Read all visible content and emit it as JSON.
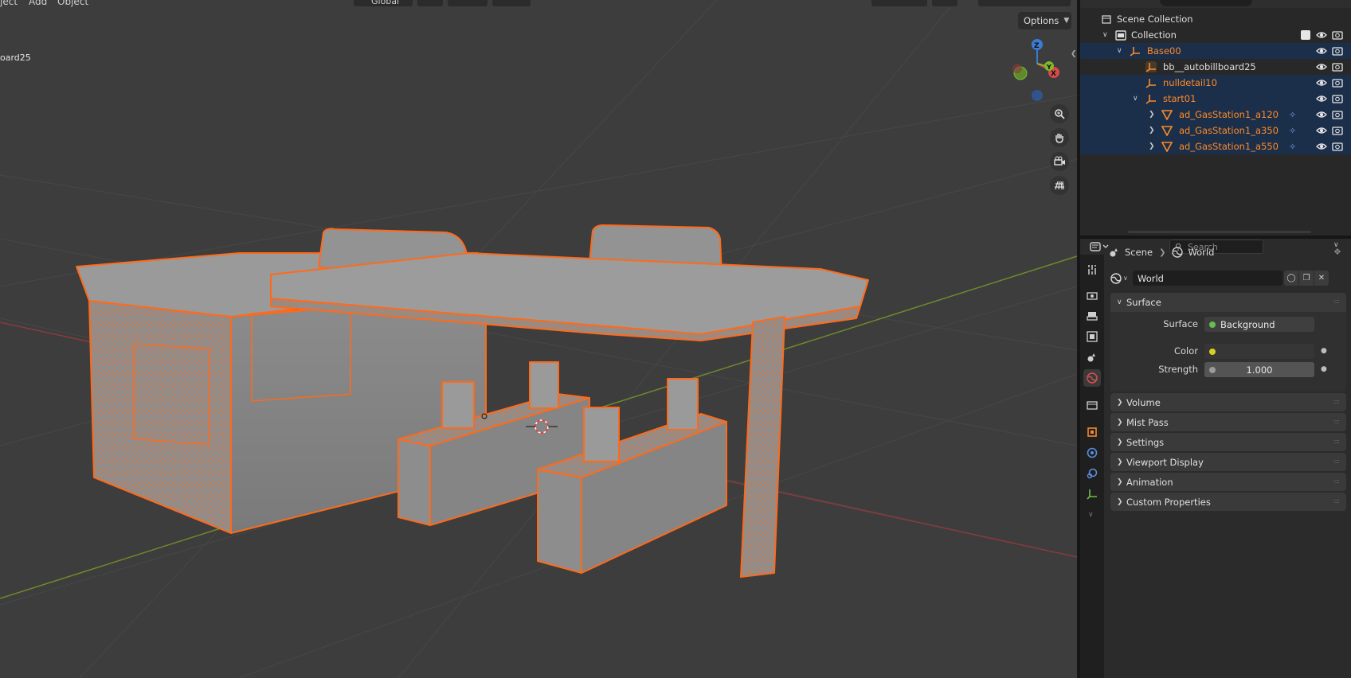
{
  "viewport": {
    "menu": [
      "ject",
      "Add",
      "Object"
    ],
    "transform_orientation": "Global",
    "active_object_label": "oard25",
    "options_label": "Options",
    "gizmo": {
      "z": "Z",
      "y": "Y",
      "x": "X"
    }
  },
  "outliner": {
    "rows": [
      {
        "label": "Scene Collection"
      },
      {
        "label": "Collection"
      },
      {
        "label": "Base00"
      },
      {
        "label": "bb__autobillboard25"
      },
      {
        "label": "nulldetail10"
      },
      {
        "label": "start01"
      },
      {
        "label": "ad_GasStation1_a120"
      },
      {
        "label": "ad_GasStation1_a350"
      },
      {
        "label": "ad_GasStation1_a550"
      }
    ]
  },
  "properties": {
    "search_placeholder": "Search",
    "breadcrumb": {
      "scene": "Scene",
      "world": "World"
    },
    "world_name": "World",
    "panels": {
      "surface": {
        "title": "Surface",
        "surface_label": "Surface",
        "surface_value": "Background",
        "color_label": "Color",
        "strength_label": "Strength",
        "strength_value": "1.000"
      },
      "volume": "Volume",
      "mist_pass": "Mist Pass",
      "settings": "Settings",
      "viewport_display": "Viewport Display",
      "animation": "Animation",
      "custom_properties": "Custom Properties"
    }
  },
  "colors": {
    "selection_orange": "#ff6a1a",
    "object_orange": "#ff8a26",
    "selected_row": "#1c2f4a",
    "surface_dot": "#63c04a",
    "color_dot": "#d8d020",
    "axis_red": "#a83a3a",
    "axis_green": "#6f8f2a"
  },
  "icons": [
    "search-icon",
    "eye-icon",
    "camera-icon",
    "collection-icon",
    "empty-icon",
    "mesh-icon",
    "wrench-icon",
    "world-icon",
    "scene-icon",
    "pin-icon",
    "tool-icon",
    "render-icon",
    "output-icon",
    "view-layer-icon",
    "physics-icon",
    "object-icon",
    "modifier-icon",
    "constraint-icon",
    "data-icon",
    "zoom-icon",
    "hand-icon",
    "camera-view-icon",
    "grid-icon"
  ]
}
